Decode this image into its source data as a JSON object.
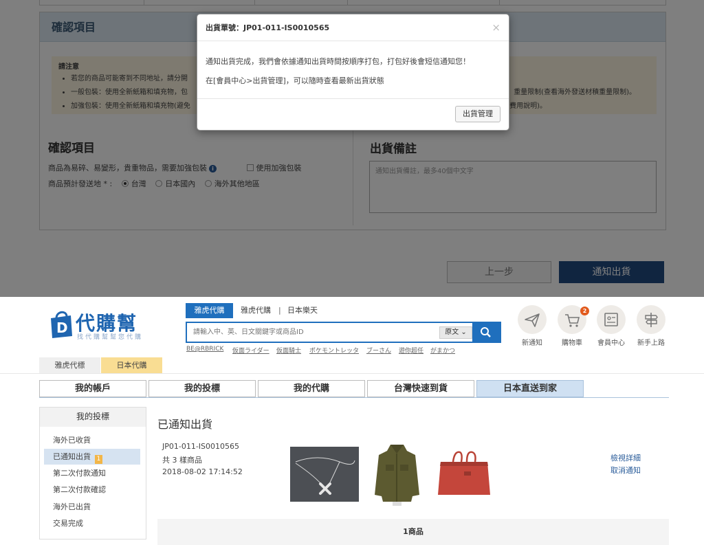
{
  "confirm_panel": {
    "header_title": "確認項目",
    "notice_title": "請注意",
    "notice_items": [
      "若您的商品可能寄到不同地址，請分開",
      "一般包裝：使用全新紙箱和填充物，包",
      "加強包裝：使用全新紙箱和填充物(避免"
    ],
    "notice_right_1": "重量限制(查看海外發送材積重量限制)。",
    "notice_right_2": "紹 費用說明)。",
    "section_title": "確認項目",
    "fragile_label": "商品為易碎、易變形，貴重物品，需要加強包裝",
    "reinforce_label": "使用加強包裝",
    "destination_label": "商品預計發送地 * :",
    "destinations": [
      "台灣",
      "日本國內",
      "海外其他地區"
    ],
    "remark_title": "出貨備註",
    "remark_placeholder": "通知出貨備註，最多40個中文字",
    "prev_button": "上一步",
    "next_button": "通知出貨"
  },
  "modal": {
    "title": "出貨單號：JP01-011-IS0010565",
    "close": "×",
    "line1": "通知出貨完成，我們會依據通知出貨時間按順序打包，打包好後會短信通知您！",
    "line2": "在[會員中心>出貨管理]，可以隨時查看最新出貨狀態",
    "button": "出貨管理"
  },
  "header": {
    "logo_text": "代購幫",
    "logo_sub": "找代購幫幫您代購",
    "search_tabs": [
      "雅虎代購",
      "雅虎代購",
      "日本樂天"
    ],
    "search_sep": "|",
    "search_placeholder": "請輸入中、英、日文關鍵字或商品ID",
    "lang": "原文",
    "hot_keywords": [
      "BE@RBRICK",
      "仮面ライダー",
      "仮面騎士",
      "ポケモントレッタ",
      "ブーさん",
      "遊你超任",
      "がまかつ"
    ],
    "icons": [
      {
        "label": "新通知",
        "icon": "paper-plane-icon"
      },
      {
        "label": "購物車",
        "icon": "cart-icon",
        "badge": "2"
      },
      {
        "label": "會員中心",
        "icon": "member-card-icon"
      },
      {
        "label": "新手上路",
        "icon": "signpost-icon"
      }
    ],
    "site_tabs": [
      "雅虎代標",
      "日本代購"
    ],
    "accent": "#1f6fbd"
  },
  "main_tabs": [
    "我的帳戶",
    "我的投標",
    "我的代購",
    "台灣快速到貨",
    "日本直送到家"
  ],
  "sidebar": {
    "title": "我的投標",
    "items": [
      {
        "label": "海外已收貨"
      },
      {
        "label": "已通知出貨",
        "badge": "1"
      },
      {
        "label": "第二次付款通知"
      },
      {
        "label": "第二次付款確認"
      },
      {
        "label": "海外已出貨"
      },
      {
        "label": "交易完成"
      }
    ]
  },
  "content": {
    "page_title": "已通知出貨",
    "order_id": "JP01-011-IS0010565",
    "item_count": "共 3 樣商品",
    "date": "2018-08-02 17:14:52",
    "view_detail": "檢視詳細",
    "cancel_notice": "取消通知",
    "footer": "1商品"
  }
}
